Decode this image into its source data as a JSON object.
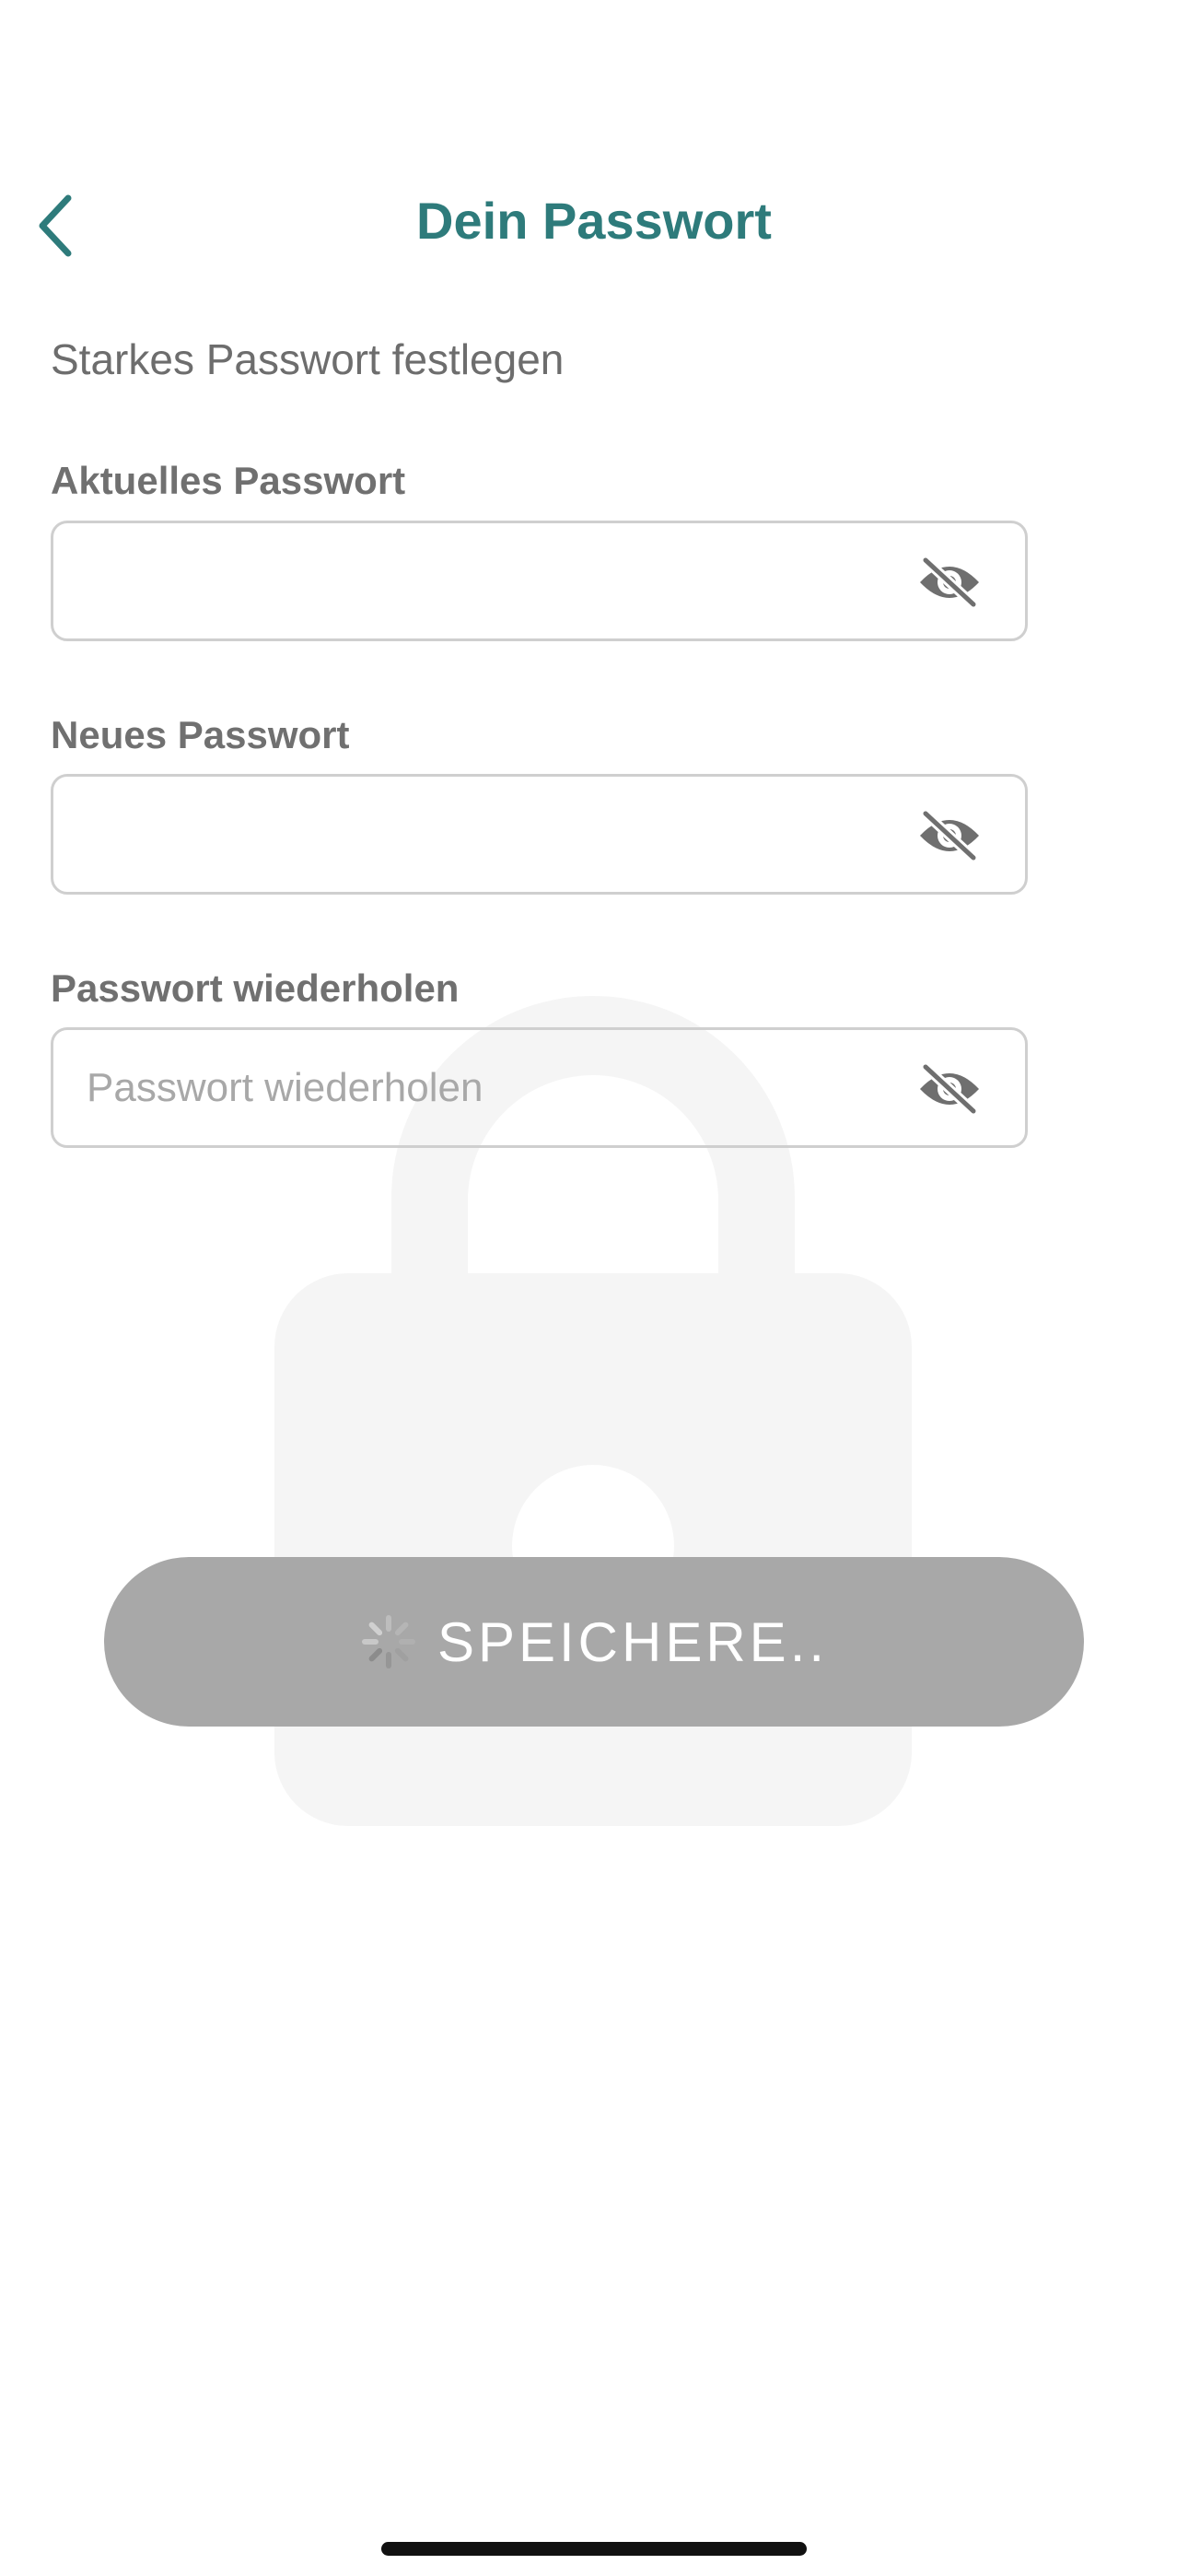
{
  "header": {
    "title": "Dein Passwort",
    "back_icon": "chevron-left-icon"
  },
  "subtitle": "Starkes Passwort festlegen",
  "fields": [
    {
      "label": "Aktuelles Passwort",
      "value": "",
      "placeholder": "",
      "toggle_icon": "eye-off-icon"
    },
    {
      "label": "Neues Passwort",
      "value": "",
      "placeholder": "",
      "toggle_icon": "eye-off-icon"
    },
    {
      "label": "Passwort wiederholen",
      "value": "",
      "placeholder": "Passwort wiederholen",
      "toggle_icon": "eye-off-icon"
    }
  ],
  "save_button": {
    "label": "SPEICHERE..",
    "state": "loading",
    "icon": "spinner-icon"
  },
  "background_icon": "lock-icon",
  "colors": {
    "accent": "#2e7b7b",
    "button_disabled": "#a8a8a8",
    "label": "#707070",
    "border": "#cfcfcf",
    "watermark": "#f5f5f5"
  }
}
